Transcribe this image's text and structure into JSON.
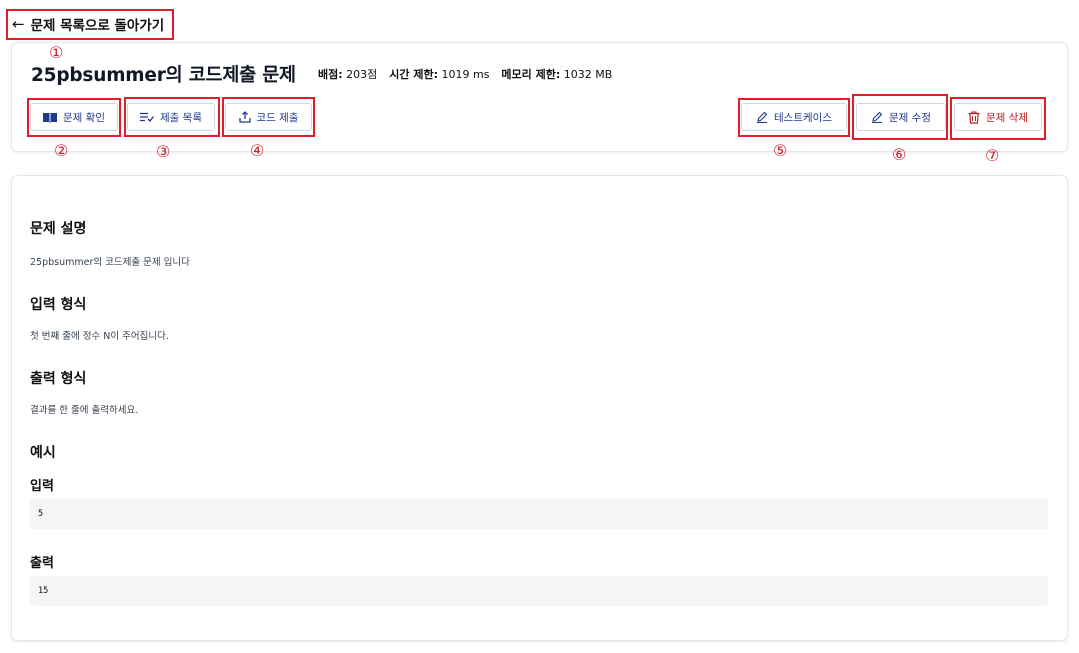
{
  "nav": {
    "back_arrow": "←",
    "back_label": "문제 목록으로 돌아가기"
  },
  "problem": {
    "title": "25pbsummer의 코드제출 문제",
    "score_label": "배점:",
    "score_value": "203점",
    "time_label": "시간 제한:",
    "time_value": "1019 ms",
    "memory_label": "메모리 제한:",
    "memory_value": "1032 MB"
  },
  "actions": {
    "view": {
      "label": "문제 확인",
      "icon": "book-icon"
    },
    "submissions": {
      "label": "제출 목록",
      "icon": "list-check-icon"
    },
    "submit": {
      "label": "코드 제출",
      "icon": "upload-icon"
    },
    "testcases": {
      "label": "테스트케이스",
      "icon": "pencil-icon"
    },
    "edit": {
      "label": "문제 수정",
      "icon": "pencil-icon"
    },
    "delete": {
      "label": "문제 삭제",
      "icon": "trash-icon"
    }
  },
  "content": {
    "description_title": "문제 설명",
    "description_text": "25pbsummer의 코드제출 문제 입니다",
    "input_title": "입력 형식",
    "input_text": "첫 번째 줄에 정수 N이 주어집니다.",
    "output_title": "출력 형식",
    "output_text": "결과를 한 줄에 출력하세요.",
    "example_title": "예시",
    "example_input_label": "입력",
    "example_input": "5",
    "example_output_label": "출력",
    "example_output": "15"
  },
  "annotations": {
    "markers": [
      "①",
      "②",
      "③",
      "④",
      "⑤",
      "⑥",
      "⑦"
    ],
    "highlight_color": "#e11d2a"
  },
  "colors": {
    "primary_text": "#1e3a8a",
    "danger": "#b91c1c"
  }
}
